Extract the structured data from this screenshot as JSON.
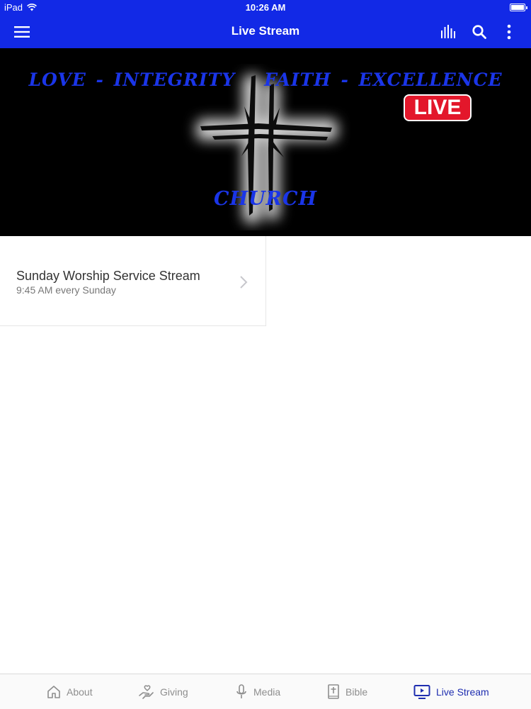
{
  "status_bar": {
    "device": "iPad",
    "time": "10:26 AM"
  },
  "nav": {
    "title": "Live Stream",
    "icons": [
      "menu-icon",
      "audio-bars-icon",
      "search-icon",
      "more-vertical-icon"
    ],
    "color": "#1229e6"
  },
  "banner": {
    "motto": "LOVE - INTEGRITY   FAITH - EXCELLENCE",
    "church": "CHURCH",
    "live_badge": "LIVE",
    "text_color": "#1a35e8",
    "badge_color": "#e3172b"
  },
  "streams": [
    {
      "title": "Sunday Worship Service Stream",
      "subtitle": "9:45 AM every Sunday"
    }
  ],
  "tabs": [
    {
      "label": "About",
      "icon": "home-icon",
      "active": false
    },
    {
      "label": "Giving",
      "icon": "giving-hand-icon",
      "active": false
    },
    {
      "label": "Media",
      "icon": "microphone-icon",
      "active": false
    },
    {
      "label": "Bible",
      "icon": "bible-icon",
      "active": false
    },
    {
      "label": "Live Stream",
      "icon": "tv-play-icon",
      "active": true
    }
  ],
  "active_tab_color": "#1f2eb0"
}
